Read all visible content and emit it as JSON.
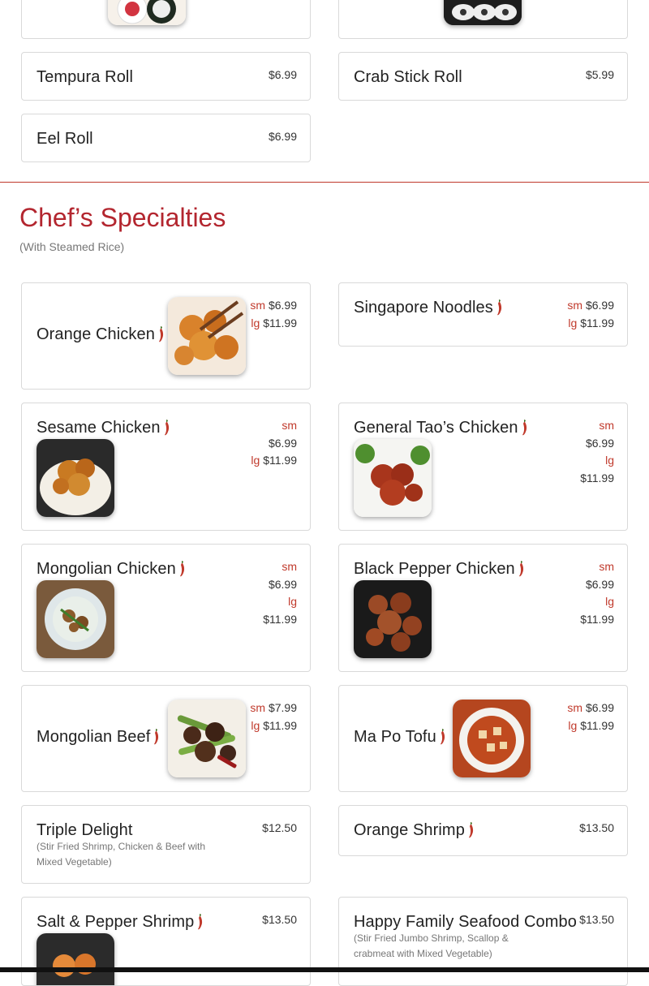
{
  "colors": {
    "accent": "#b3262f",
    "size_label": "#c0392b",
    "border": "#d9d9d9"
  },
  "prev_section": {
    "items": [
      {
        "name": "Tempura Roll",
        "price": "$6.99"
      },
      {
        "name": "Crab Stick Roll",
        "price": "$5.99"
      },
      {
        "name": "Eel Roll",
        "price": "$6.99"
      }
    ]
  },
  "section": {
    "title": "Chef’s Specialties",
    "subtitle": "(With Steamed Rice)"
  },
  "items": [
    {
      "name": "Orange Chicken",
      "spicy": true,
      "sm_label": "sm",
      "sm_price": "$6.99",
      "lg_label": "lg",
      "lg_price": "$11.99",
      "image": "orange-chicken-photo"
    },
    {
      "name": "Singapore Noodles",
      "spicy": true,
      "sm_label": "sm",
      "sm_price": "$6.99",
      "lg_label": "lg",
      "lg_price": "$11.99"
    },
    {
      "name": "Sesame Chicken",
      "spicy": true,
      "sm_label": "sm",
      "sm_price": "$6.99",
      "lg_label": "lg",
      "lg_price": "$11.99",
      "image": "sesame-chicken-photo"
    },
    {
      "name": "General Tao’s Chicken",
      "spicy": true,
      "sm_label": "sm",
      "sm_price": "$6.99",
      "lg_label": "lg",
      "lg_price": "$11.99",
      "image": "general-taos-chicken-photo"
    },
    {
      "name": "Mongolian Chicken",
      "spicy": true,
      "sm_label": "sm",
      "sm_price": "$6.99",
      "lg_label": "lg",
      "lg_price": "$11.99",
      "image": "mongolian-chicken-photo"
    },
    {
      "name": "Black Pepper Chicken",
      "spicy": true,
      "sm_label": "sm",
      "sm_price": "$6.99",
      "lg_label": "lg",
      "lg_price": "$11.99",
      "image": "black-pepper-chicken-photo"
    },
    {
      "name": "Mongolian Beef",
      "spicy": true,
      "sm_label": "sm",
      "sm_price": "$7.99",
      "lg_label": "lg",
      "lg_price": "$11.99",
      "image": "mongolian-beef-photo"
    },
    {
      "name": "Ma Po Tofu",
      "spicy": true,
      "sm_label": "sm",
      "sm_price": "$6.99",
      "lg_label": "lg",
      "lg_price": "$11.99",
      "image": "ma-po-tofu-photo"
    },
    {
      "name": "Triple Delight",
      "price": "$12.50",
      "desc": "(Stir Fried Shrimp, Chicken & Beef with Mixed Vegetable)"
    },
    {
      "name": "Orange Shrimp",
      "spicy": true,
      "price": "$13.50"
    },
    {
      "name": "Salt & Pepper Shrimp",
      "spicy": true,
      "price": "$13.50",
      "image": "salt-pepper-shrimp-photo"
    },
    {
      "name": "Happy Family Seafood Combo",
      "price": "$13.50",
      "desc": "(Stir Fried Jumbo Shrimp, Scallop & crabmeat with Mixed Vegetable)"
    }
  ]
}
